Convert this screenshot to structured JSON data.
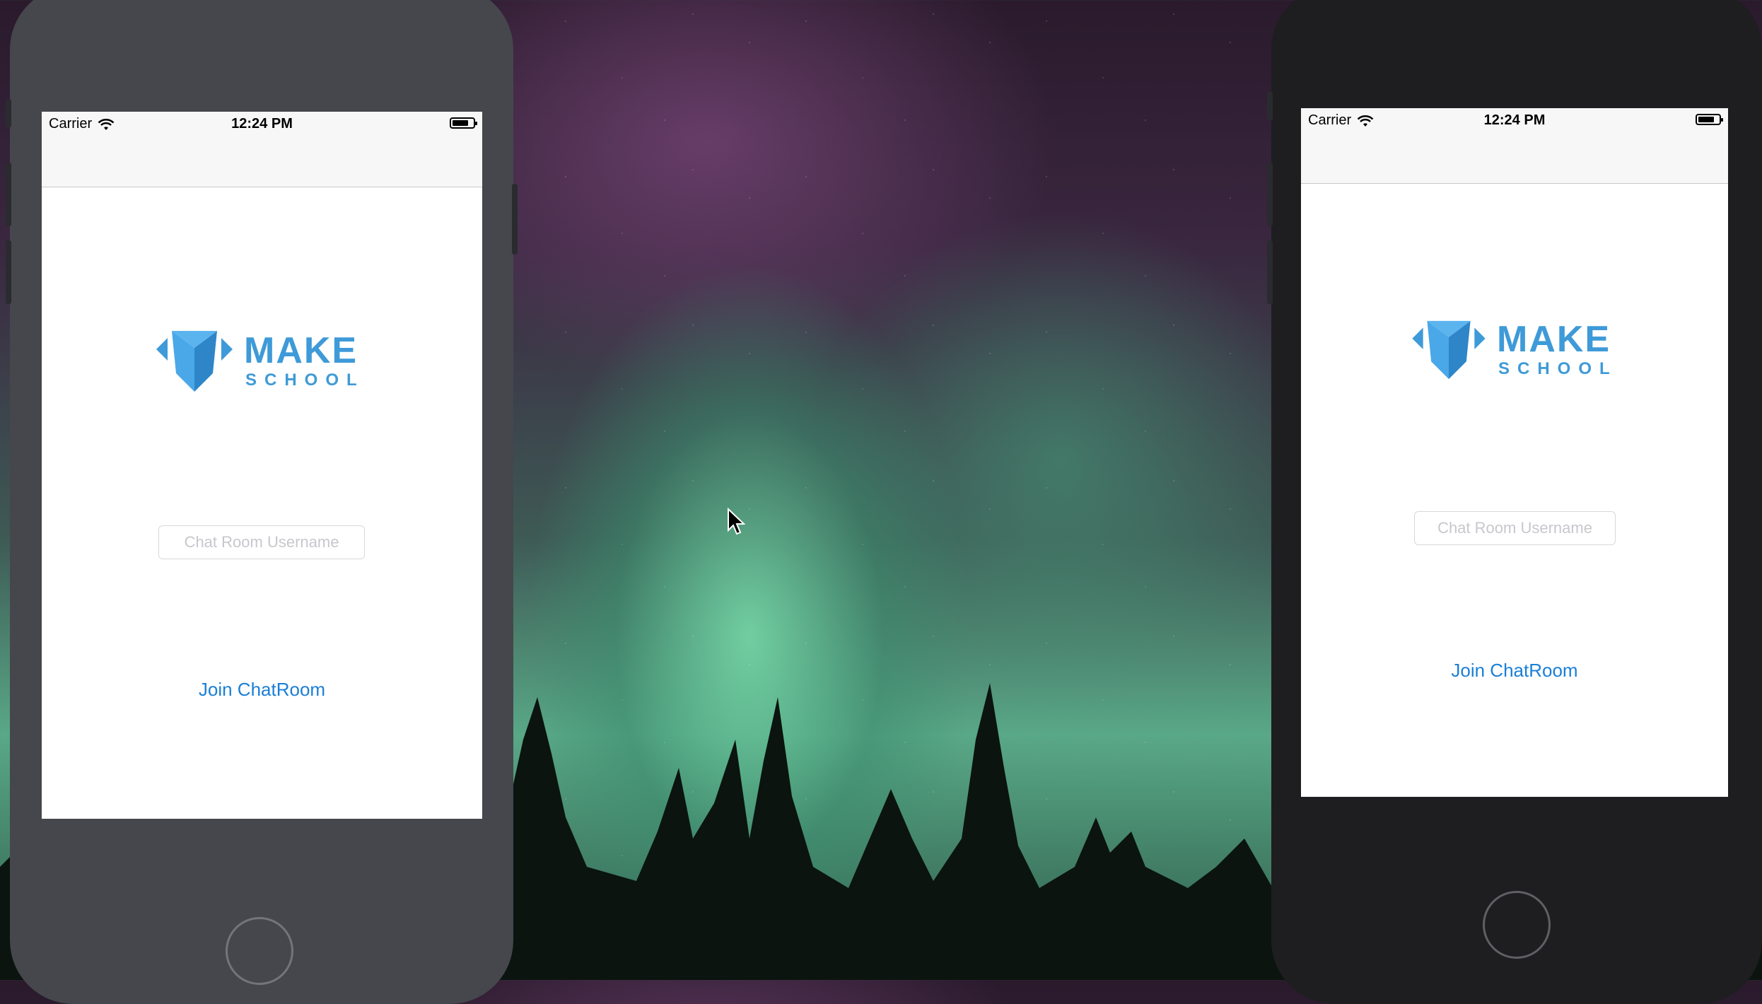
{
  "colors": {
    "brand": "#3e9ad8",
    "link": "#1b7fd6",
    "placeholder": "#c7c7cd"
  },
  "simulators": [
    {
      "status": {
        "carrier": "Carrier",
        "time": "12:24 PM"
      },
      "logo": {
        "line1": "MAKE",
        "line2": "SCHOOL"
      },
      "username_input": {
        "value": "",
        "placeholder": "Chat Room Username"
      },
      "join_button": "Join ChatRoom"
    },
    {
      "status": {
        "carrier": "Carrier",
        "time": "12:24 PM"
      },
      "logo": {
        "line1": "MAKE",
        "line2": "SCHOOL"
      },
      "username_input": {
        "value": "",
        "placeholder": "Chat Room Username"
      },
      "join_button": "Join ChatRoom"
    }
  ]
}
